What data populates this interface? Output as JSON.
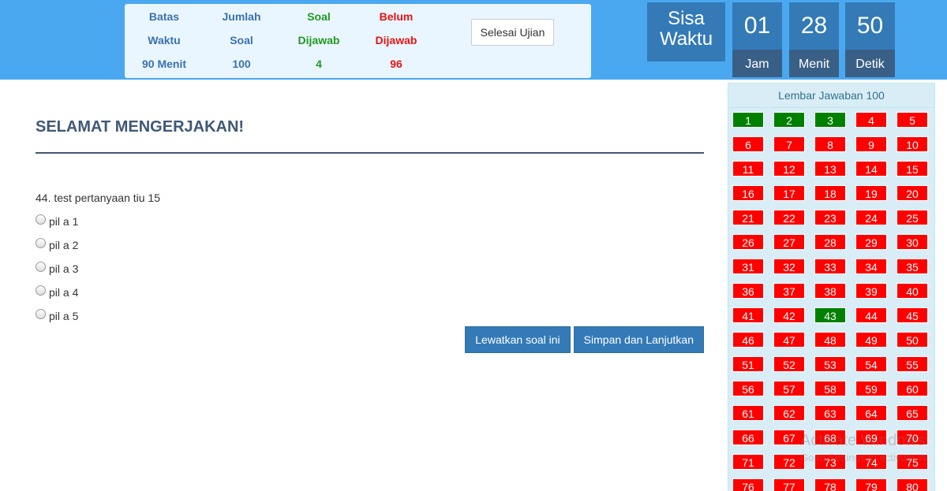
{
  "stats": {
    "batas": {
      "line1": "Batas",
      "line2": "Waktu",
      "value": "90 Menit"
    },
    "jumlah": {
      "line1": "Jumlah",
      "line2": "Soal",
      "value": "100"
    },
    "dijawab": {
      "line1": "Soal",
      "line2": "Dijawab",
      "value": "4"
    },
    "belum": {
      "line1": "Belum",
      "line2": "Dijawab",
      "value": "96"
    }
  },
  "finish_label": "Selesai Ujian",
  "timer": {
    "title_line1": "Sisa",
    "title_line2": "Waktu",
    "hours": "01",
    "hours_label": "Jam",
    "minutes": "28",
    "minutes_label": "Menit",
    "seconds": "50",
    "seconds_label": "Detik"
  },
  "main": {
    "title": "SELAMAT MENGERJAKAN!",
    "question": "44. test pertanyaan tiu 15",
    "options": [
      "pil a 1",
      "pil a 2",
      "pil a 3",
      "pil a 4",
      "pil a 5"
    ],
    "skip_label": "Lewatkan soal ini",
    "save_label": "Simpan dan Lanjutkan"
  },
  "sheet": {
    "title": "Lembar Jawaban 100",
    "visible_numbers": [
      "1",
      "2",
      "3",
      "4",
      "5",
      "6",
      "7",
      "8",
      "9",
      "10",
      "11",
      "12",
      "13",
      "14",
      "15",
      "16",
      "17",
      "18",
      "19",
      "20",
      "21",
      "22",
      "23",
      "24",
      "25",
      "26",
      "27",
      "28",
      "29",
      "30",
      "31",
      "32",
      "33",
      "34",
      "35",
      "36",
      "37",
      "38",
      "39",
      "40",
      "41",
      "42",
      "43",
      "44",
      "45",
      "46",
      "47",
      "48",
      "49",
      "50",
      "51",
      "52",
      "53",
      "54",
      "55",
      "56",
      "57",
      "58",
      "59",
      "60",
      "61",
      "62",
      "63",
      "64",
      "65",
      "66",
      "67",
      "68",
      "69",
      "70",
      "71",
      "72",
      "73",
      "74",
      "75",
      "76",
      "77",
      "78",
      "79",
      "80"
    ],
    "answered": [
      "1",
      "2",
      "3",
      "43"
    ],
    "color_answered": "#008000",
    "color_unanswered": "#ff0000"
  },
  "watermark": {
    "line1": "Activate Windows",
    "line2": "Go to Settings to activate W"
  }
}
